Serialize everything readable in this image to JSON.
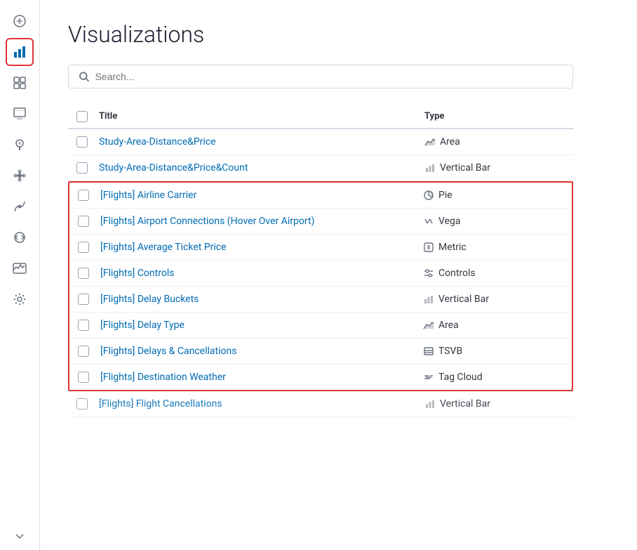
{
  "page": {
    "title": "Visualizations"
  },
  "search": {
    "placeholder": "Search..."
  },
  "table": {
    "columns": [
      "",
      "Title",
      "Type"
    ],
    "regular_rows": [
      {
        "title": "Study-Area-Distance&Price",
        "type": "Area",
        "type_icon": "area"
      },
      {
        "title": "Study-Area-Distance&Price&Count",
        "type": "Vertical Bar",
        "type_icon": "vertical-bar"
      }
    ],
    "highlighted_rows": [
      {
        "title": "[Flights] Airline Carrier",
        "type": "Pie",
        "type_icon": "pie"
      },
      {
        "title": "[Flights] Airport Connections (Hover Over Airport)",
        "type": "Vega",
        "type_icon": "vega"
      },
      {
        "title": "[Flights] Average Ticket Price",
        "type": "Metric",
        "type_icon": "metric"
      },
      {
        "title": "[Flights] Controls",
        "type": "Controls",
        "type_icon": "controls"
      },
      {
        "title": "[Flights] Delay Buckets",
        "type": "Vertical Bar",
        "type_icon": "vertical-bar"
      },
      {
        "title": "[Flights] Delay Type",
        "type": "Area",
        "type_icon": "area"
      },
      {
        "title": "[Flights] Delays & Cancellations",
        "type": "TSVB",
        "type_icon": "tsvb"
      },
      {
        "title": "[Flights] Destination Weather",
        "type": "Tag Cloud",
        "type_icon": "tag-cloud"
      }
    ],
    "partial_row": {
      "title": "[Flights] Flight Cancellations",
      "type": "Vertical Bar",
      "type_icon": "vertical-bar"
    }
  },
  "sidebar": {
    "items": [
      {
        "label": "Discover",
        "icon": "compass"
      },
      {
        "label": "Visualize",
        "icon": "bar-chart",
        "active": true
      },
      {
        "label": "Dashboard",
        "icon": "dashboard"
      },
      {
        "label": "Canvas",
        "icon": "canvas"
      },
      {
        "label": "Maps",
        "icon": "maps"
      },
      {
        "label": "Graph",
        "icon": "graph"
      },
      {
        "label": "Machine Learning",
        "icon": "ml"
      },
      {
        "label": "Dev Tools",
        "icon": "dev-tools"
      },
      {
        "label": "Monitoring",
        "icon": "monitoring"
      },
      {
        "label": "Management",
        "icon": "gear"
      }
    ]
  }
}
